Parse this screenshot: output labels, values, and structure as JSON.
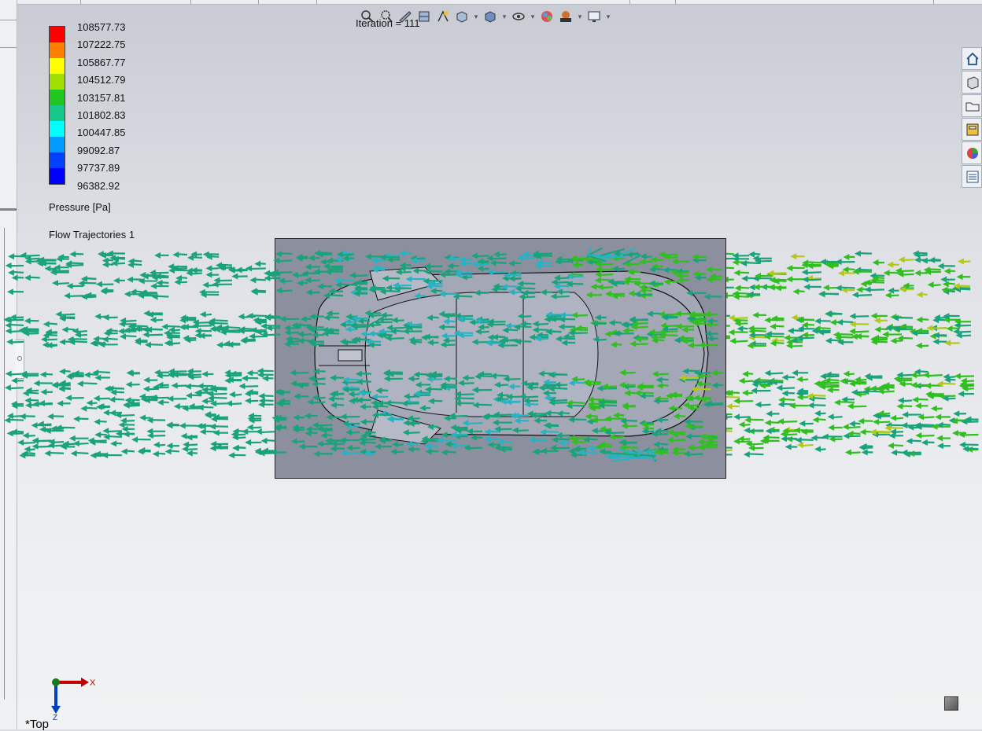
{
  "legend": {
    "values": [
      "108577.73",
      "107222.75",
      "105867.77",
      "104512.79",
      "103157.81",
      "101802.83",
      "100447.85",
      "99092.87",
      "97737.89",
      "96382.92"
    ],
    "colors": [
      "#ff0000",
      "#ff7f00",
      "#ffff00",
      "#9fe000",
      "#1fc71f",
      "#16c88a",
      "#00ffff",
      "#009bff",
      "#0040ff",
      "#0000ff"
    ],
    "units": "Pressure [Pa]"
  },
  "trajectory_label": "Flow Trajectories 1",
  "iteration_text": "Iteration = 111",
  "view_name": "*Top",
  "triad": {
    "x_label": "X",
    "z_label": "Z"
  },
  "toolbar": {
    "icons": [
      "zoom-to-fit-icon",
      "zoom-to-area-icon",
      "previous-view-icon",
      "section-view-icon",
      "dynamic-annotation-icon",
      "view-orientation-icon",
      "display-style-icon",
      "hide-show-items-icon",
      "edit-appearance-icon",
      "apply-scene-icon",
      "view-settings-icon"
    ]
  },
  "taskpane": {
    "icons": [
      "home-icon",
      "3d-parts-icon",
      "folder-icon",
      "view-palette-icon",
      "appearances-icon",
      "custom-properties-icon"
    ]
  },
  "flow_colors": {
    "main": "#1aa37a",
    "cyan": "#27b3c4",
    "green": "#2fbf1f",
    "yellow": "#b4c81a",
    "body": "#8c8f9e",
    "car": "#a4a7b5"
  }
}
